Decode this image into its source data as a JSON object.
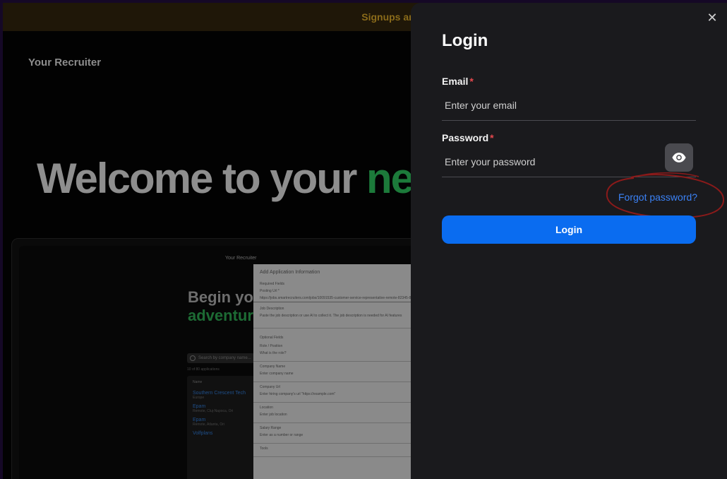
{
  "background": {
    "banner": "Signups are now available for BET",
    "brand": "Your Recruiter",
    "hero_text": "Welcome to your ",
    "hero_accent": "ne",
    "preview": {
      "brand": "Your Recruiter",
      "title_line1": "Begin yo",
      "title_line2": "adventur",
      "search_placeholder": "Search by company name...",
      "count": "10 of 80 applications",
      "list_header": "Name",
      "items": [
        {
          "title": "Southern Crescent Tech",
          "sub": "Europe"
        },
        {
          "title": "Epam",
          "sub": "Remote, Cluj-Napoca, Ori"
        },
        {
          "title": "Epam",
          "sub": "Remote, Atlanta, Ori"
        },
        {
          "title": "Volfplans",
          "sub": ""
        }
      ],
      "modal": {
        "title": "Add Application Information",
        "required": "Required Fields",
        "posting_url_label": "Posting Url *",
        "posting_url_value": "https://jobs.smartrecruiters.com/jobs/10091535-customer-service-representative-remote-82345-8",
        "job_desc_label": "Job Description",
        "job_desc_hint": "Paste the job description or use AI to collect it. The job description is needed for AI features",
        "optional": "Optional Fields",
        "fields": [
          {
            "label": "Role / Position",
            "hint": "What is the role?"
          },
          {
            "label": "Company Name",
            "hint": "Enter company name"
          },
          {
            "label": "Company Url",
            "hint": "Enter hiring company's url \"https://example.com\""
          },
          {
            "label": "Location",
            "hint": "Enter job location"
          },
          {
            "label": "Salary Range",
            "hint": "Enter as a number or range"
          },
          {
            "label": "Tools",
            "hint": ""
          }
        ]
      }
    }
  },
  "login": {
    "title": "Login",
    "email_label": "Email",
    "email_placeholder": "Enter your email",
    "password_label": "Password",
    "password_placeholder": "Enter your password",
    "required_mark": "*",
    "forgot": "Forgot password?",
    "submit": "Login",
    "close_glyph": "✕",
    "close_icon": "close-icon",
    "eye_icon": "eye-icon"
  },
  "colors": {
    "accent": "#0a6cf0",
    "link": "#3b82f6",
    "required": "#e5484d",
    "annotation": "#8b1a1a",
    "hero_accent": "#1c7a3a"
  }
}
